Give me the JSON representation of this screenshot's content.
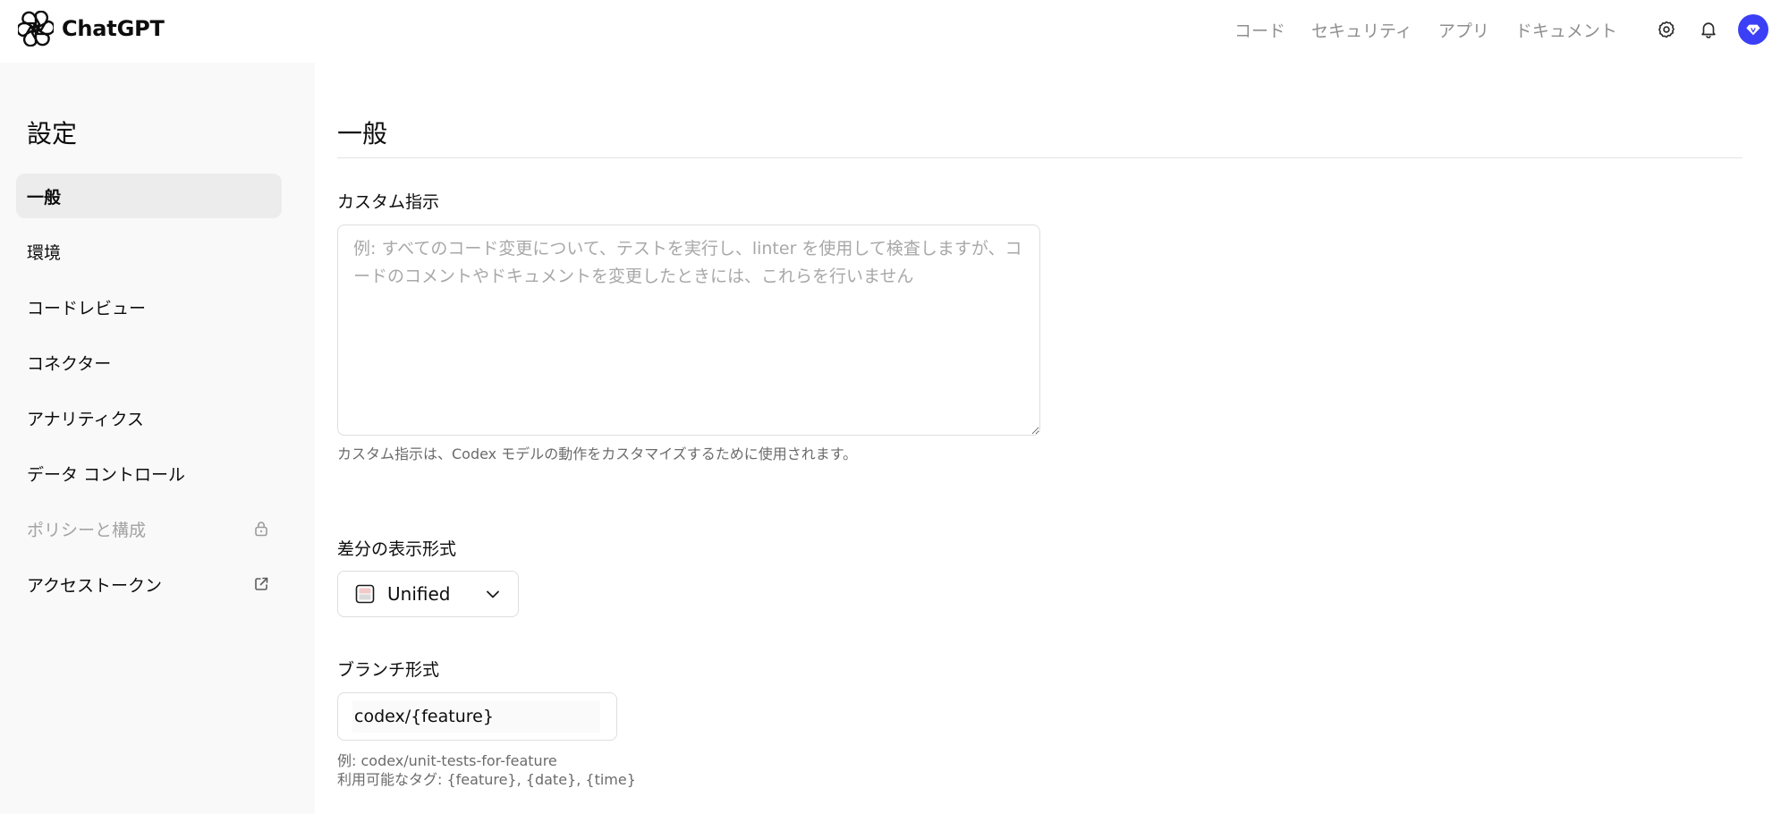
{
  "header": {
    "brand_name": "ChatGPT",
    "nav": [
      "コード",
      "セキュリティ",
      "アプリ",
      "ドキュメント"
    ],
    "icons": {
      "logo": "openai-logo-icon",
      "settings": "gear-icon",
      "notifications": "bell-icon",
      "avatar": "diamond-avatar-icon"
    },
    "avatar_color": "#3b3ff5"
  },
  "sidebar": {
    "title": "設定",
    "items": [
      {
        "label": "一般",
        "active": true
      },
      {
        "label": "環境"
      },
      {
        "label": "コードレビュー"
      },
      {
        "label": "コネクター"
      },
      {
        "label": "アナリティクス"
      },
      {
        "label": "データ コントロール"
      },
      {
        "label": "ポリシーと構成",
        "disabled": true,
        "trailing_icon": "lock-icon"
      },
      {
        "label": "アクセストークン",
        "trailing_icon": "external-link-icon"
      }
    ]
  },
  "main": {
    "title": "一般",
    "custom_instructions": {
      "label": "カスタム指示",
      "value": "",
      "placeholder": "例: すべてのコード変更について、テストを実行し、linter を使用して検査しますが、コードのコメントやドキュメントを変更したときには、これらを行いません",
      "helper": "カスタム指示は、Codex モデルの動作をカスタマイズするために使用されます。"
    },
    "diff_format": {
      "label": "差分の表示形式",
      "selected": "Unified",
      "icon": "unified-diff-icon"
    },
    "branch_format": {
      "label": "ブランチ形式",
      "value": "codex/{feature}",
      "example": "例: codex/unit-tests-for-feature",
      "tags": "利用可能なタグ: {feature}, {date}, {time}"
    }
  }
}
